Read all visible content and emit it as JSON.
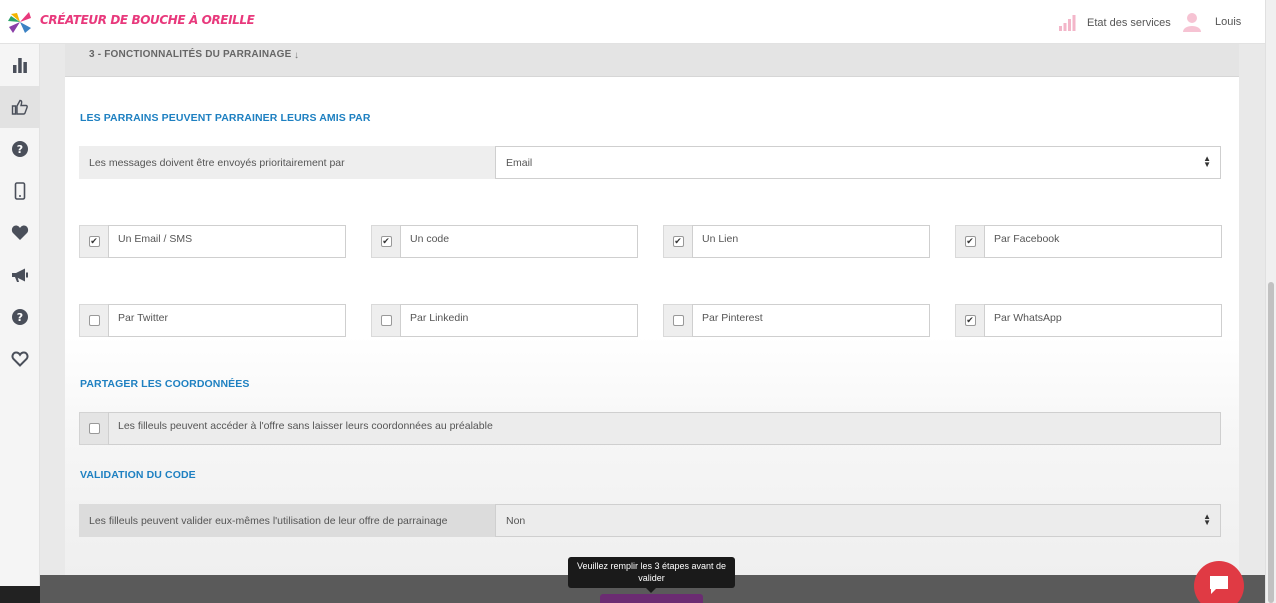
{
  "app": {
    "logo_text": "Créateur de bouche à oreille",
    "brand_color": "#e8397c",
    "accent_color": "#1e80c1"
  },
  "topbar": {
    "status_label": "Etat des services",
    "user_name": "Louis"
  },
  "sidebar": {
    "items": [
      {
        "icon": "bar-chart-icon",
        "active": false
      },
      {
        "icon": "thumbs-up-icon",
        "active": true
      },
      {
        "icon": "help-circle-icon",
        "active": false
      },
      {
        "icon": "mobile-phone-icon",
        "active": false
      },
      {
        "icon": "heart-icon",
        "active": false
      },
      {
        "icon": "megaphone-icon",
        "active": false
      },
      {
        "icon": "help-circle-icon",
        "active": false
      },
      {
        "icon": "heart-outline-icon",
        "active": false
      }
    ]
  },
  "section": {
    "title": "3 - FONCTIONNALITÉS DU PARRAINAGE",
    "arrow": "↓"
  },
  "sponsors": {
    "heading": "LES PARRAINS PEUVENT PARRAINER LEURS AMIS PAR",
    "priority_label": "Les messages doivent être envoyés prioritairement par",
    "priority_value": "Email",
    "options": [
      {
        "label": "Un Email / SMS",
        "checked": true
      },
      {
        "label": "Un code",
        "checked": true
      },
      {
        "label": "Un Lien",
        "checked": true
      },
      {
        "label": "Par Facebook",
        "checked": true
      },
      {
        "label": "Par Twitter",
        "checked": false
      },
      {
        "label": "Par Linkedin",
        "checked": false
      },
      {
        "label": "Par Pinterest",
        "checked": false
      },
      {
        "label": "Par WhatsApp",
        "checked": true
      }
    ]
  },
  "share": {
    "heading": "PARTAGER LES COORDONNÉES",
    "option_label": "Les filleuls peuvent accéder à l'offre sans laisser leurs coordonnées au préalable",
    "checked": false
  },
  "validation": {
    "heading": "VALIDATION DU CODE",
    "label": "Les filleuls peuvent valider eux-mêmes l'utilisation de leur offre de parrainage",
    "value": "Non"
  },
  "tooltip": {
    "text": "Veuillez remplir les 3 étapes avant de valider"
  }
}
